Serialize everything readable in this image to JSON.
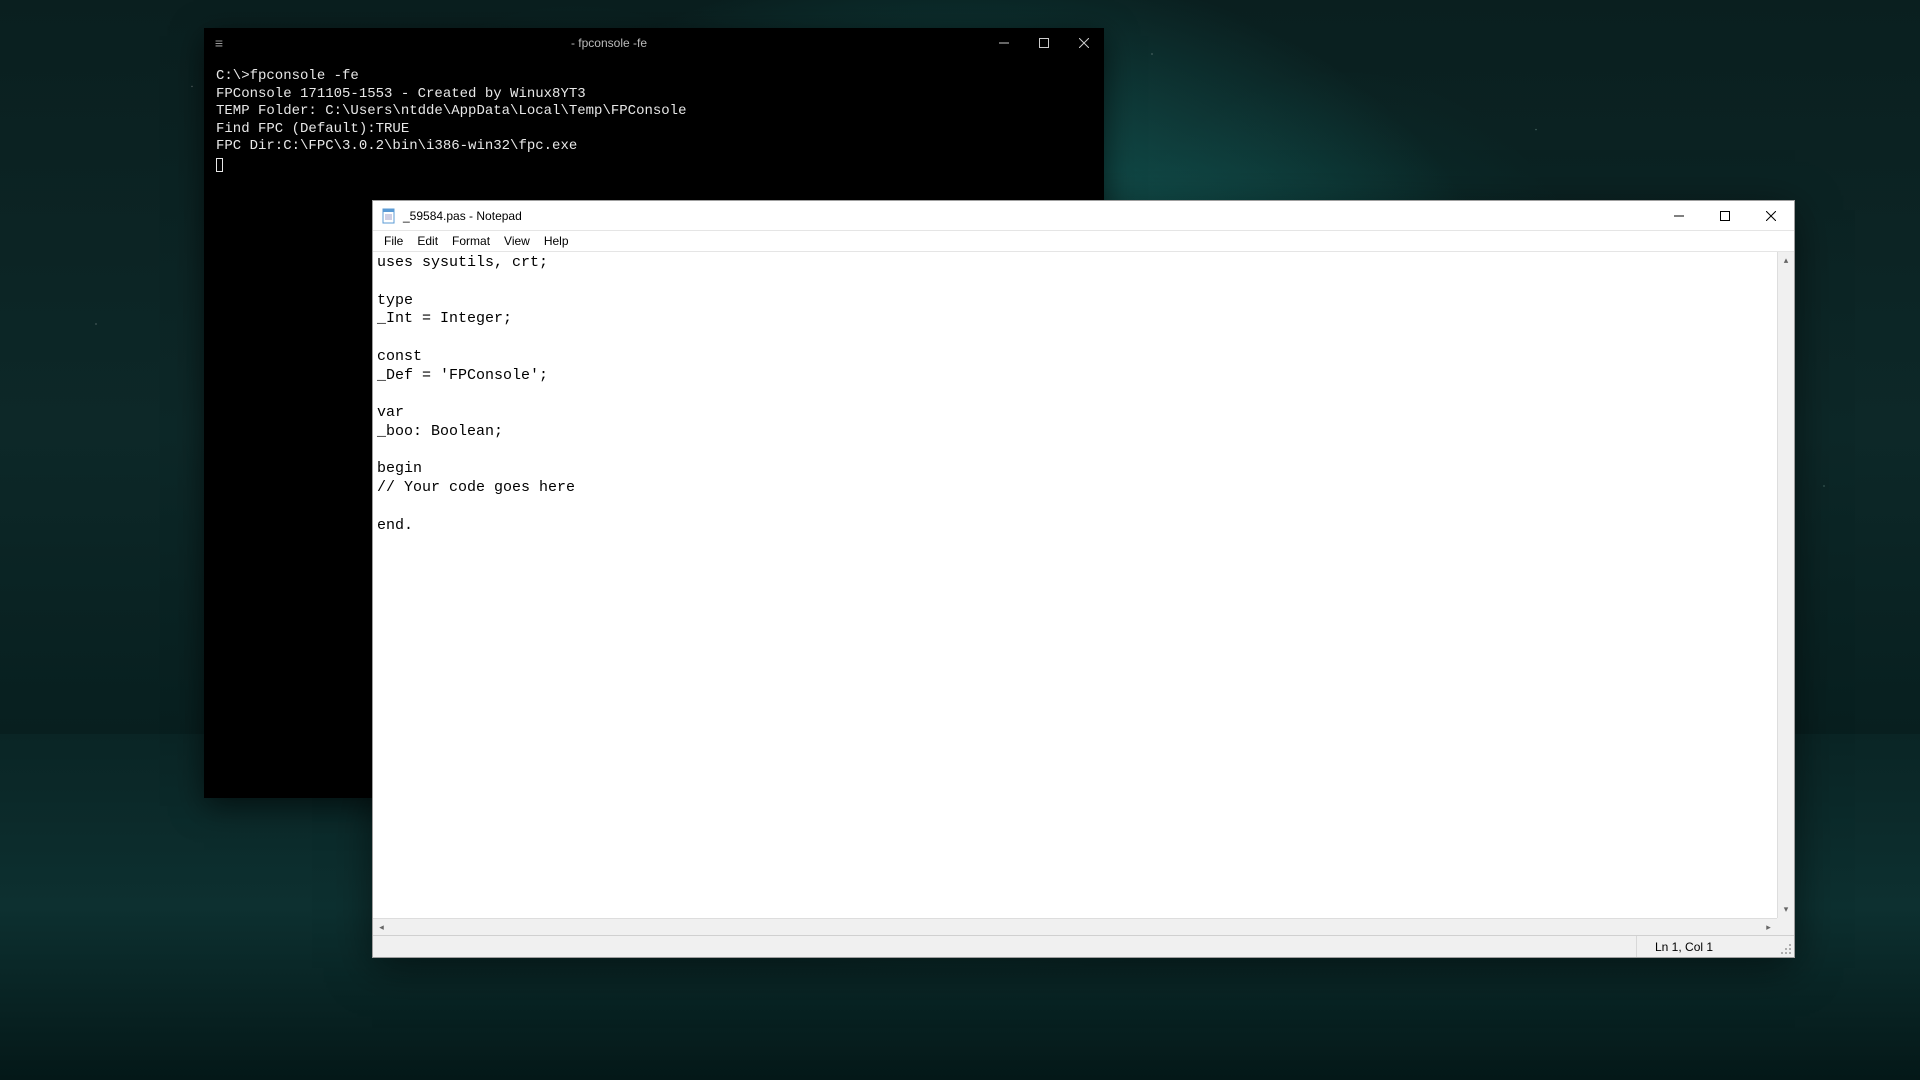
{
  "console": {
    "title": "- fpconsole -fe",
    "lines": [
      "C:\\>fpconsole -fe",
      "FPConsole 171105-1553 - Created by Winux8YT3",
      "TEMP Folder: C:\\Users\\ntdde\\AppData\\Local\\Temp\\FPConsole",
      "Find FPC (Default):TRUE",
      "FPC Dir:C:\\FPC\\3.0.2\\bin\\i386-win32\\fpc.exe"
    ]
  },
  "notepad": {
    "title": "_59584.pas - Notepad",
    "menu": {
      "file": "File",
      "edit": "Edit",
      "format": "Format",
      "view": "View",
      "help": "Help"
    },
    "content": "uses sysutils, crt;\n\ntype\n_Int = Integer;\n\nconst\n_Def = 'FPConsole';\n\nvar\n_boo: Boolean;\n\nbegin\n// Your code goes here\n\nend.",
    "status": {
      "position": "Ln 1, Col 1"
    }
  }
}
